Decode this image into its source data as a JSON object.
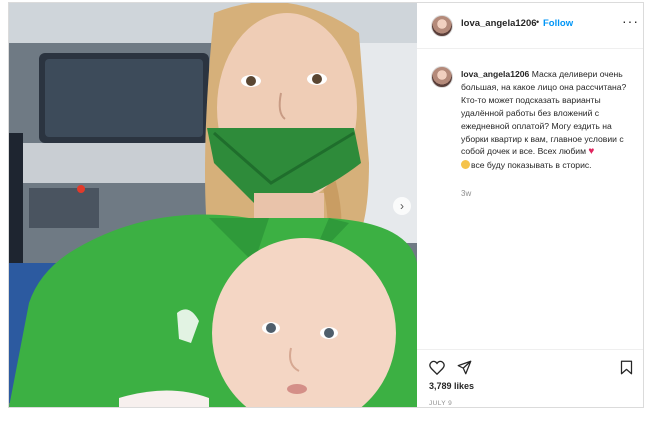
{
  "post": {
    "username": "lova_angela1206",
    "dot": "•",
    "follow_label": "Follow",
    "more_icon": "more-horizontal-icon",
    "caption_text": "Маска деливери очень большая, на какое лицо она рассчитана? Кто-то может подсказать варианты удалённой работы без вложений с ежедневной оплатой? Могу ездить на уборки квартир к вам, главное условии с собой дочек и все. Всех любим",
    "caption_after_emoji": "все буду показывать в сторис.",
    "emoji_1": "red-heart-emoji",
    "emoji_2": "smiling-face-emoji",
    "time_ago": "3w",
    "likes": "3,789 likes",
    "date": "JULY 9"
  },
  "photo": {
    "description_icon": "photo",
    "next_arrow": "›"
  },
  "colors": {
    "follow": "#0095f6",
    "mask_green": "#2e8b3a",
    "shirt_green": "#3cb043"
  }
}
